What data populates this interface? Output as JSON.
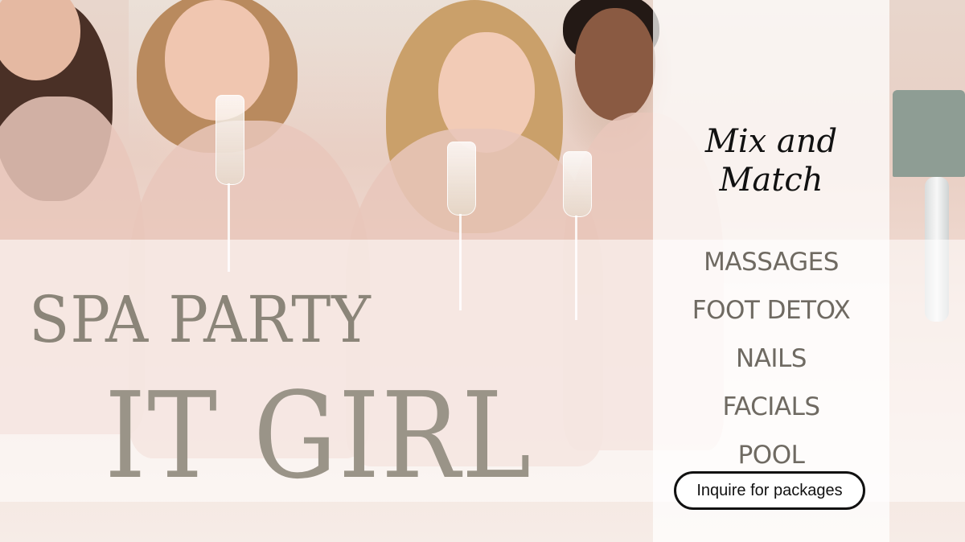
{
  "title": {
    "line1": "SPA PARTY",
    "line2": "IT GIRL"
  },
  "panel": {
    "heading": "Mix and Match",
    "services": [
      "MASSAGES",
      "FOOT DETOX",
      "NAILS",
      "FACIALS",
      "POOL"
    ],
    "cta_label": "Inquire for packages"
  },
  "colors": {
    "title_text": "#8b8579",
    "service_text": "#6f6a62",
    "heading_text": "#111111",
    "robe_pink": "#e9c7bb"
  }
}
